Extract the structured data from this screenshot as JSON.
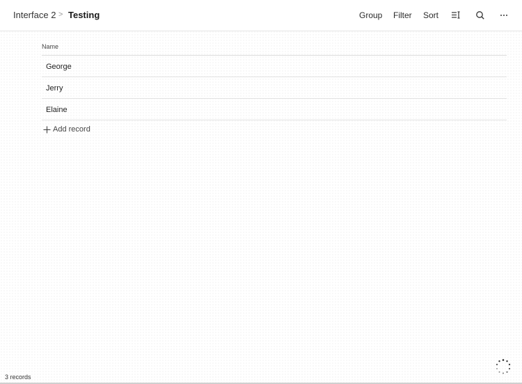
{
  "breadcrumb": {
    "parent": "Interface 2",
    "separator": ">",
    "current": "Testing"
  },
  "toolbar": {
    "group_label": "Group",
    "filter_label": "Filter",
    "sort_label": "Sort",
    "icons": [
      "row-height-icon",
      "search-icon",
      "more-options-icon"
    ]
  },
  "table": {
    "column_header": "Name",
    "rows": [
      "George",
      "Jerry",
      "Elaine"
    ]
  },
  "add_record_label": "Add record",
  "footer": {
    "record_count": "3 records"
  }
}
